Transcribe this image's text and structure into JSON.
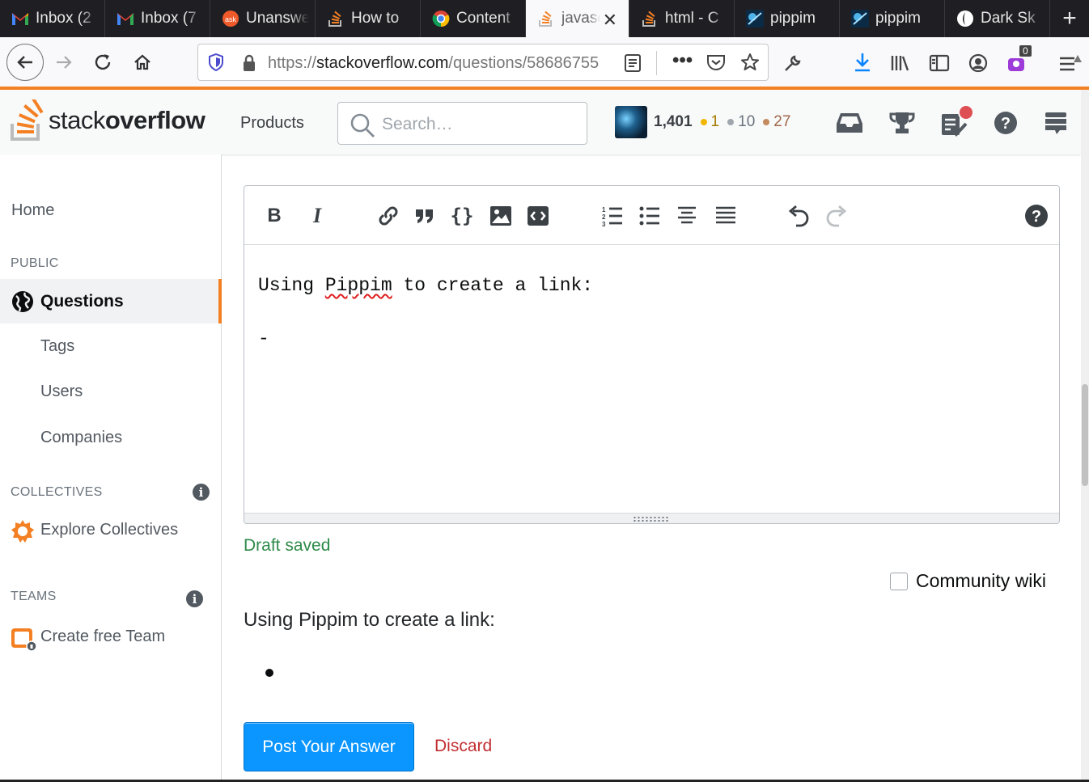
{
  "browser": {
    "tabs": [
      {
        "title": "Inbox (2",
        "icon": "gmail-icon"
      },
      {
        "title": "Inbox (7",
        "icon": "gmail-icon"
      },
      {
        "title": "Unanswered",
        "icon": "askubuntu-icon"
      },
      {
        "title": "How to",
        "icon": "stackoverflow-icon"
      },
      {
        "title": "Content",
        "icon": "chrome-icon"
      },
      {
        "title": "javascript",
        "icon": "stackoverflow-icon",
        "active": true
      },
      {
        "title": "html - C",
        "icon": "stackoverflow-icon"
      },
      {
        "title": "pippim",
        "icon": "pippim-icon"
      },
      {
        "title": "pippim",
        "icon": "pippim-icon"
      },
      {
        "title": "Dark Sk",
        "icon": "darksky-icon"
      }
    ],
    "url_prefix": "https://",
    "url_host": "stackoverflow.com",
    "url_path": "/questions/58686755",
    "extension_badge": "0"
  },
  "so_header": {
    "logo_light": "stack",
    "logo_bold": "overflow",
    "products_label": "Products",
    "search_placeholder": "Search…",
    "reputation": "1,401",
    "gold_badges": "1",
    "silver_badges": "10",
    "bronze_badges": "27",
    "colors": {
      "accent": "#f48024",
      "gold": "#f1b600",
      "silver": "#9fa6ad",
      "bronze": "#c38b5f"
    }
  },
  "sidebar": {
    "home": "Home",
    "public_heading": "PUBLIC",
    "questions": "Questions",
    "tags": "Tags",
    "users": "Users",
    "companies": "Companies",
    "collectives_heading": "COLLECTIVES",
    "explore_collectives": "Explore Collectives",
    "teams_heading": "TEAMS",
    "create_team": "Create free Team"
  },
  "editor": {
    "line1_before": "Using ",
    "line1_misspelled": "Pippim",
    "line1_after": " to create a link:",
    "line2": "-",
    "draft_status": "Draft saved",
    "community_wiki_label": "Community wiki"
  },
  "preview": {
    "paragraph": "Using Pippim to create a link:"
  },
  "actions": {
    "post_label": "Post Your Answer",
    "discard_label": "Discard"
  }
}
